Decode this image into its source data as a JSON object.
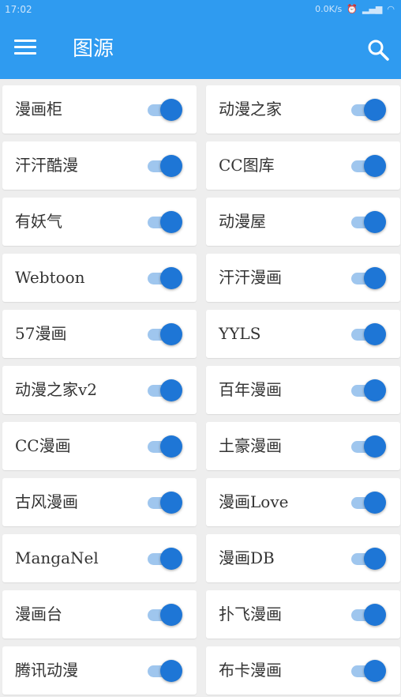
{
  "status_bar": {
    "time": "17:02",
    "right_text": "0.0K/s"
  },
  "app_bar": {
    "title": "图源",
    "accent": "#2f9bf0"
  },
  "sources": [
    {
      "label": "漫画柜",
      "enabled": true
    },
    {
      "label": "动漫之家",
      "enabled": true
    },
    {
      "label": "汗汗酷漫",
      "enabled": true
    },
    {
      "label": "CC图库",
      "enabled": true
    },
    {
      "label": "有妖气",
      "enabled": true
    },
    {
      "label": "动漫屋",
      "enabled": true
    },
    {
      "label": "Webtoon",
      "enabled": true
    },
    {
      "label": "汗汗漫画",
      "enabled": true
    },
    {
      "label": "57漫画",
      "enabled": true
    },
    {
      "label": "YYLS",
      "enabled": true
    },
    {
      "label": "动漫之家v2",
      "enabled": true
    },
    {
      "label": "百年漫画",
      "enabled": true
    },
    {
      "label": "CC漫画",
      "enabled": true
    },
    {
      "label": "土豪漫画",
      "enabled": true
    },
    {
      "label": "古风漫画",
      "enabled": true
    },
    {
      "label": "漫画Love",
      "enabled": true
    },
    {
      "label": "MangaNel",
      "enabled": true
    },
    {
      "label": "漫画DB",
      "enabled": true
    },
    {
      "label": "漫画台",
      "enabled": true
    },
    {
      "label": "扑飞漫画",
      "enabled": true
    },
    {
      "label": "腾讯动漫",
      "enabled": true
    },
    {
      "label": "布卡漫画",
      "enabled": true
    }
  ]
}
